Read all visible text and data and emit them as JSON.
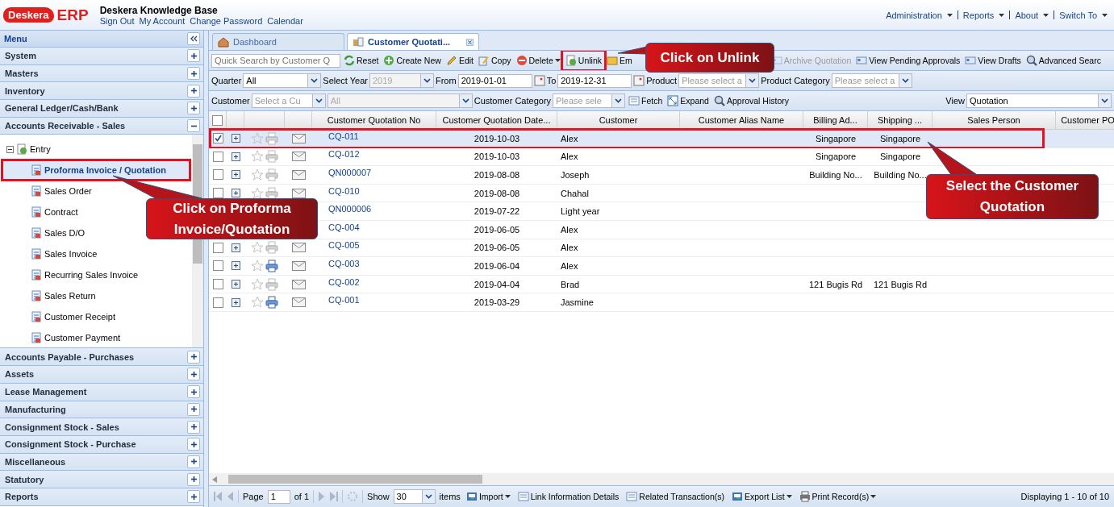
{
  "header": {
    "logo": {
      "brand": "Deskera",
      "product": "ERP"
    },
    "title": "Deskera Knowledge Base",
    "links": [
      "Sign Out",
      "My Account",
      "Change Password",
      "Calendar"
    ],
    "menus": [
      "Administration",
      "Reports",
      "About",
      "Switch To"
    ]
  },
  "sidebar": {
    "title": "Menu",
    "sections": [
      {
        "label": "System",
        "expanded": false
      },
      {
        "label": "Masters",
        "expanded": false
      },
      {
        "label": "Inventory",
        "expanded": false
      },
      {
        "label": "General Ledger/Cash/Bank",
        "expanded": false
      },
      {
        "label": "Accounts Receivable - Sales",
        "expanded": true,
        "children": [
          {
            "label": "Entry",
            "expanded": true,
            "children": [
              {
                "label": "Proforma Invoice / Quotation",
                "selected": true,
                "highlighted": true
              },
              {
                "label": "Sales Order",
                "selected": false,
                "highlighted": false
              },
              {
                "label": "Contract",
                "selected": false,
                "highlighted": false
              },
              {
                "label": "Sales D/O",
                "selected": false,
                "highlighted": false
              },
              {
                "label": "Sales Invoice",
                "selected": false,
                "highlighted": false
              },
              {
                "label": "Recurring Sales Invoice",
                "selected": false,
                "highlighted": false
              },
              {
                "label": "Sales Return",
                "selected": false,
                "highlighted": false
              },
              {
                "label": "Customer Receipt",
                "selected": false,
                "highlighted": false
              },
              {
                "label": "Customer Payment",
                "selected": false,
                "highlighted": false
              }
            ]
          }
        ]
      },
      {
        "label": "Accounts Payable - Purchases",
        "expanded": false
      },
      {
        "label": "Assets",
        "expanded": false
      },
      {
        "label": "Lease Management",
        "expanded": false
      },
      {
        "label": "Manufacturing",
        "expanded": false
      },
      {
        "label": "Consignment Stock - Sales",
        "expanded": false
      },
      {
        "label": "Consignment Stock - Purchase",
        "expanded": false
      },
      {
        "label": "Miscellaneous",
        "expanded": false
      },
      {
        "label": "Statutory",
        "expanded": false
      },
      {
        "label": "Reports",
        "expanded": false
      }
    ]
  },
  "tabs": [
    {
      "label": "Dashboard",
      "selected": false,
      "closable": false
    },
    {
      "label": "Customer Quotati...",
      "selected": true,
      "closable": true
    }
  ],
  "toolbar": {
    "search": {
      "placeholder": "Quick Search by Customer Q"
    },
    "buttons": [
      {
        "kind": "reset",
        "label": "Reset",
        "disabled": false,
        "dropdown": false,
        "highlighted": false
      },
      {
        "kind": "add",
        "label": "Create New",
        "disabled": false,
        "dropdown": false,
        "highlighted": false
      },
      {
        "kind": "edit",
        "label": "Edit",
        "disabled": false,
        "dropdown": false,
        "highlighted": false
      },
      {
        "kind": "copy",
        "label": "Copy",
        "disabled": false,
        "dropdown": false,
        "highlighted": false
      },
      {
        "kind": "delete",
        "label": "Delete",
        "disabled": false,
        "dropdown": true,
        "highlighted": false
      },
      {
        "kind": "unlink",
        "label": "Unlink",
        "disabled": false,
        "dropdown": false,
        "highlighted": true
      },
      {
        "kind": "email",
        "label": "Em",
        "disabled": false,
        "highlighted": false
      },
      {
        "kind": "archive",
        "label": "Archive Quotation",
        "disabled": true,
        "dropdown": false,
        "highlighted": false
      },
      {
        "kind": "card",
        "label": "View Pending Approvals",
        "disabled": false,
        "dropdown": false,
        "highlighted": false
      },
      {
        "kind": "card",
        "label": "View Drafts",
        "disabled": false,
        "dropdown": false,
        "highlighted": false
      },
      {
        "kind": "search",
        "label": "Advanced Searc",
        "disabled": false,
        "dropdown": false,
        "highlighted": false
      }
    ]
  },
  "filters": [
    [
      {
        "kind": "label",
        "text": "Quarter"
      },
      {
        "kind": "combo",
        "value": "All",
        "disabled": false
      },
      {
        "kind": "label",
        "text": "Select Year"
      },
      {
        "kind": "combo",
        "value": "2019",
        "disabled": true
      },
      {
        "kind": "label",
        "text": "From"
      },
      {
        "kind": "date",
        "value": "2019-01-01"
      },
      {
        "kind": "label",
        "text": "To"
      },
      {
        "kind": "date",
        "value": "2019-12-31"
      },
      {
        "kind": "label",
        "text": "Product"
      },
      {
        "kind": "combo",
        "placeholder": "Please select a",
        "disabled": false
      },
      {
        "kind": "label",
        "text": "Product Category"
      },
      {
        "kind": "combo",
        "placeholder": "Please select a",
        "disabled": false
      }
    ],
    [
      {
        "kind": "label",
        "text": "Customer"
      },
      {
        "kind": "combo",
        "placeholder": "Select a Cu",
        "disabled": false
      },
      {
        "kind": "combo",
        "value": "All",
        "disabled": true
      },
      {
        "kind": "label",
        "text": "Customer Category"
      },
      {
        "kind": "combo",
        "placeholder": "Please sele",
        "disabled": false
      },
      {
        "kind": "fetch",
        "text": "Fetch"
      },
      {
        "kind": "expand",
        "text": "Expand"
      },
      {
        "kind": "history",
        "text": "Approval History"
      },
      {
        "kind": "spacer"
      },
      {
        "kind": "label",
        "text": "View"
      },
      {
        "kind": "combo",
        "value": "Quotation",
        "disabled": false
      }
    ]
  ],
  "grid": {
    "all_checked": false,
    "columns": [
      "Customer Quotation No",
      "Customer Quotation Date...",
      "Customer",
      "Customer Alias Name",
      "Billing Ad...",
      "Shipping ...",
      "Sales Person",
      "Customer PO"
    ],
    "rows": [
      {
        "selected": true,
        "highlighted": true,
        "printed": false,
        "no": "CQ-011",
        "date": "2019-10-03",
        "customer": "Alex",
        "billing": "Singapore",
        "shipping": "Singapore"
      },
      {
        "selected": false,
        "highlighted": false,
        "printed": false,
        "no": "CQ-012",
        "date": "2019-10-03",
        "customer": "Alex",
        "billing": "Singapore",
        "shipping": "Singapore"
      },
      {
        "selected": false,
        "highlighted": false,
        "printed": false,
        "no": "QN000007",
        "date": "2019-08-08",
        "customer": "Joseph",
        "billing": "Building No...",
        "shipping": "Building No..."
      },
      {
        "selected": false,
        "highlighted": false,
        "printed": false,
        "no": "CQ-010",
        "date": "2019-08-08",
        "customer": "Chahal"
      },
      {
        "highlighted": false,
        "no": "QN000006",
        "date": "2019-07-22",
        "customer": "Light year"
      },
      {
        "highlighted": false,
        "no": "CQ-004",
        "date": "2019-06-05",
        "customer": "Alex"
      },
      {
        "selected": false,
        "highlighted": false,
        "printed": false,
        "no": "CQ-005",
        "date": "2019-06-05",
        "customer": "Alex"
      },
      {
        "selected": false,
        "highlighted": false,
        "printed": true,
        "no": "CQ-003",
        "date": "2019-06-04",
        "customer": "Alex"
      },
      {
        "selected": false,
        "highlighted": false,
        "printed": false,
        "no": "CQ-002",
        "date": "2019-04-04",
        "customer": "Brad",
        "billing": "121 Bugis Rd",
        "shipping": "121 Bugis Rd"
      },
      {
        "selected": false,
        "highlighted": false,
        "printed": true,
        "no": "CQ-001",
        "date": "2019-03-29",
        "customer": "Jasmine"
      }
    ]
  },
  "paging": {
    "page_label": "Page",
    "page": "1",
    "of": "of 1",
    "show_label": "Show",
    "page_size": "30",
    "items_label": "items",
    "buttons": [
      {
        "kind": "import",
        "label": "Import",
        "dropdown": true
      },
      {
        "kind": "link",
        "label": "Link Information Details",
        "dropdown": false
      },
      {
        "kind": "related",
        "label": "Related Transaction(s)",
        "dropdown": false
      },
      {
        "kind": "export",
        "label": "Export List",
        "dropdown": true
      },
      {
        "kind": "print",
        "label": "Print Record(s)",
        "dropdown": true
      }
    ],
    "display": "Displaying 1 - 10 of 10"
  },
  "annotations": [
    {
      "kind": "unlink",
      "text": "Click on Unlink"
    },
    {
      "kind": "menu",
      "text": "Click on Proforma Invoice/Quotation"
    },
    {
      "kind": "row",
      "text": "Select the Customer Quotation"
    }
  ]
}
